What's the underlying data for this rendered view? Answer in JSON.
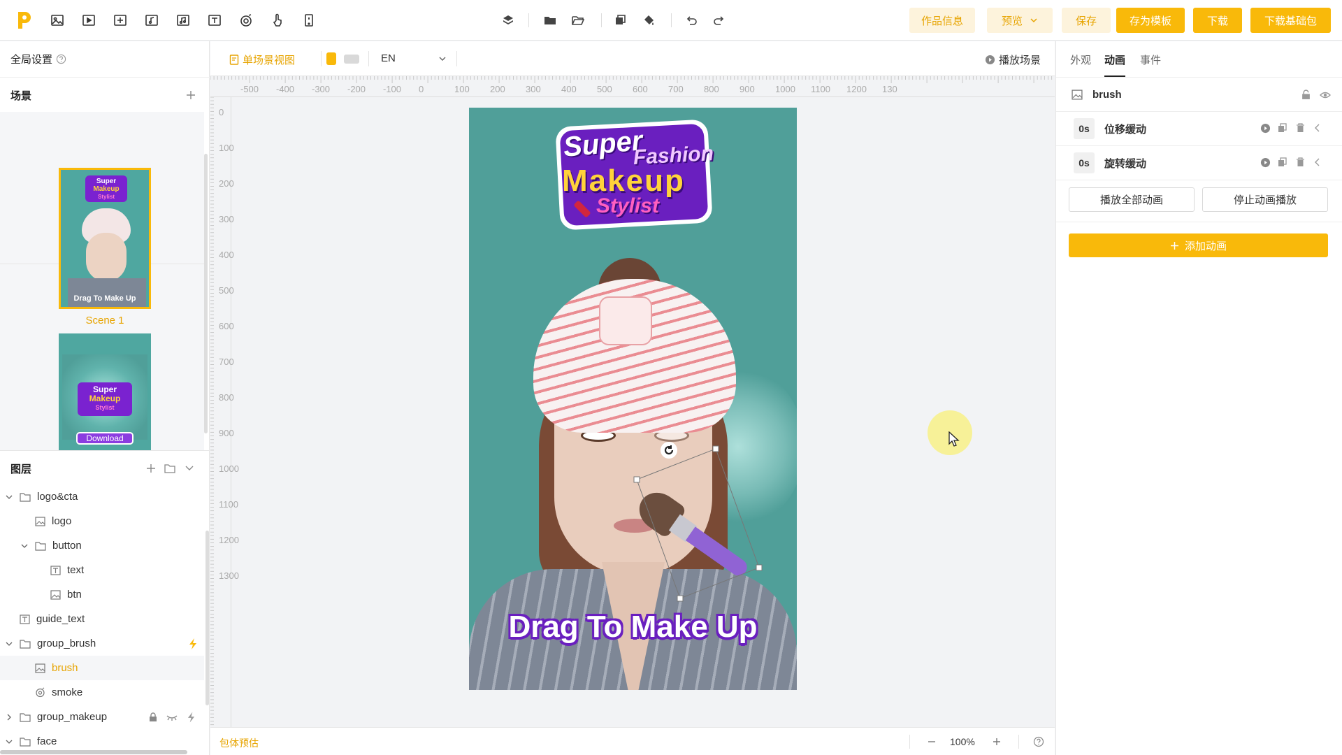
{
  "colors": {
    "accent": "#f9b90a",
    "accent_text": "#e7a400",
    "light_accent_bg": "#fdf3dc",
    "stage_bg": "#509f99",
    "brand_purple": "#6a1fbf"
  },
  "toolbar": {
    "left_icons": [
      "image-icon",
      "video-icon",
      "transform-icon",
      "audio-icon",
      "music-icon",
      "text-icon",
      "particle-icon",
      "touch-icon",
      "phone-icon"
    ],
    "center_icons": [
      "layers-icon",
      "folder-icon",
      "folder-open-icon",
      "copy-icon",
      "paint-icon",
      "undo-icon",
      "redo-icon"
    ],
    "work_info": "作品信息",
    "preview": "预览",
    "save": "保存",
    "save_template": "存为模板",
    "download": "下载",
    "download_base": "下载基础包"
  },
  "left": {
    "global_settings": "全局设置",
    "scenes_title": "场景",
    "scene1_label": "Scene 1",
    "layers_title": "图层",
    "layers": [
      {
        "label": "logo&cta",
        "type": "folder"
      },
      {
        "label": "logo",
        "type": "image"
      },
      {
        "label": "button",
        "type": "folder"
      },
      {
        "label": "text",
        "type": "text"
      },
      {
        "label": "btn",
        "type": "image"
      },
      {
        "label": "guide_text",
        "type": "text"
      },
      {
        "label": "group_brush",
        "type": "folder"
      },
      {
        "label": "brush",
        "type": "image"
      },
      {
        "label": "smoke",
        "type": "particle"
      },
      {
        "label": "group_makeup",
        "type": "folder"
      },
      {
        "label": "face",
        "type": "folder"
      }
    ]
  },
  "canvas": {
    "single_scene_view": "单场景视图",
    "language": "EN",
    "play_scene": "播放场景",
    "package_estimate": "包体预估",
    "zoom": "100%",
    "ruler_h": [
      "-500",
      "-400",
      "-300",
      "-200",
      "-100",
      "0",
      "100",
      "200",
      "300",
      "400",
      "500",
      "600",
      "700",
      "800",
      "900",
      "1000",
      "1100",
      "1200",
      "130"
    ],
    "ruler_v": [
      "0",
      "100",
      "200",
      "300",
      "400",
      "500",
      "600",
      "700",
      "800",
      "900",
      "1000",
      "1100",
      "1200",
      "1300"
    ]
  },
  "stage": {
    "logo_line1": "Super",
    "logo_line2": "Fashion",
    "logo_line3": "Makeup",
    "logo_line4": "Stylist",
    "guide_text": "Drag To Make Up",
    "thumb2_button": "Download",
    "thumb1_guide": "Drag To Make Up"
  },
  "right": {
    "tabs": [
      "外观",
      "动画",
      "事件"
    ],
    "active_tab": 1,
    "selected_layer": "brush",
    "animations": [
      {
        "time": "0s",
        "name": "位移缓动"
      },
      {
        "time": "0s",
        "name": "旋转缓动"
      }
    ],
    "play_all": "播放全部动画",
    "stop_all": "停止动画播放",
    "add_animation": "添加动画"
  }
}
